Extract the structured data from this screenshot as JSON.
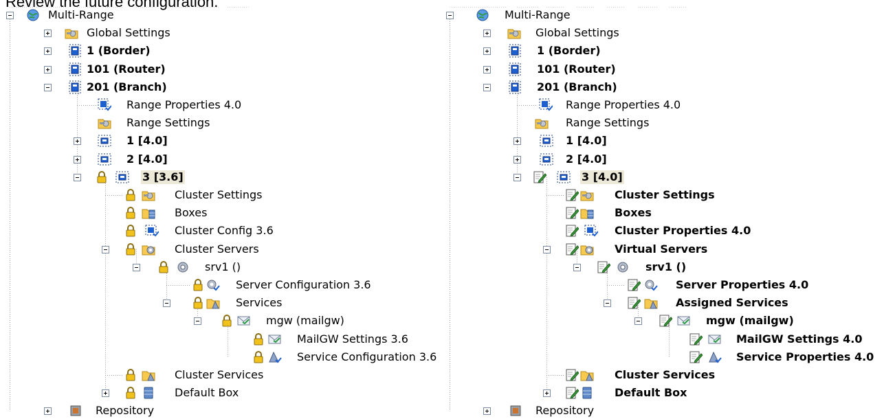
{
  "heading": "Review the future configuration.",
  "colors": {
    "tree_line": "#9c9c9c",
    "toggle_border": "#7a8aa5",
    "selection_bg": "#ece9d8",
    "folder": "#f7c94e",
    "node_blue": "#1e5fd0",
    "lock": "#f1c21b"
  },
  "left_tree": {
    "nodes": [
      {
        "label": "Multi-Range",
        "icon": "globe-icon"
      },
      {
        "label": "Global Settings",
        "icon": "settings-folder-icon"
      },
      {
        "label": "1 (Border)",
        "icon": "range-icon"
      },
      {
        "label": "101 (Router)",
        "icon": "range-icon"
      },
      {
        "label": "201 (Branch)",
        "icon": "range-icon"
      },
      {
        "label": "Range Properties 4.0",
        "icon": "range-properties-icon"
      },
      {
        "label": "Range Settings",
        "icon": "settings-folder-icon"
      },
      {
        "label": "1 [4.0]",
        "icon": "cluster-icon"
      },
      {
        "label": "2 [4.0]",
        "icon": "cluster-icon"
      },
      {
        "label": "3 [3.6]",
        "icon": "cluster-icon"
      },
      {
        "label": "Cluster Settings",
        "icon": "settings-folder-icon"
      },
      {
        "label": "Boxes",
        "icon": "boxes-folder-icon"
      },
      {
        "label": "Cluster Config 3.6",
        "icon": "cluster-config-icon"
      },
      {
        "label": "Cluster Servers",
        "icon": "servers-folder-icon"
      },
      {
        "label": "srv1 ()",
        "icon": "server-gear-icon"
      },
      {
        "label": "Server Configuration 3.6",
        "icon": "server-config-icon"
      },
      {
        "label": "Services",
        "icon": "services-folder-icon"
      },
      {
        "label": "mgw (mailgw)",
        "icon": "mail-icon"
      },
      {
        "label": "MailGW Settings 3.6",
        "icon": "mail-icon"
      },
      {
        "label": "Service Configuration 3.6",
        "icon": "service-config-icon"
      },
      {
        "label": "Cluster Services",
        "icon": "services-folder-icon"
      },
      {
        "label": "Default Box",
        "icon": "box-icon"
      },
      {
        "label": "Repository",
        "icon": "repository-icon"
      }
    ]
  },
  "right_tree": {
    "nodes": [
      {
        "label": "Multi-Range",
        "icon": "globe-icon"
      },
      {
        "label": "Global Settings",
        "icon": "settings-folder-icon"
      },
      {
        "label": "1 (Border)",
        "icon": "range-icon"
      },
      {
        "label": "101 (Router)",
        "icon": "range-icon"
      },
      {
        "label": "201 (Branch)",
        "icon": "range-icon"
      },
      {
        "label": "Range Properties 4.0",
        "icon": "range-properties-icon"
      },
      {
        "label": "Range Settings",
        "icon": "settings-folder-icon"
      },
      {
        "label": "1 [4.0]",
        "icon": "cluster-icon"
      },
      {
        "label": "2 [4.0]",
        "icon": "cluster-icon"
      },
      {
        "label": "3 [4.0]",
        "icon": "cluster-icon"
      },
      {
        "label": "Cluster Settings",
        "icon": "settings-folder-icon"
      },
      {
        "label": "Boxes",
        "icon": "boxes-folder-icon"
      },
      {
        "label": "Cluster Properties 4.0",
        "icon": "cluster-config-icon"
      },
      {
        "label": "Virtual Servers",
        "icon": "servers-folder-icon"
      },
      {
        "label": "srv1 ()",
        "icon": "server-gear-icon"
      },
      {
        "label": "Server Properties 4.0",
        "icon": "server-config-icon"
      },
      {
        "label": "Assigned Services",
        "icon": "services-folder-icon"
      },
      {
        "label": "mgw (mailgw)",
        "icon": "mail-icon"
      },
      {
        "label": "MailGW Settings 4.0",
        "icon": "mail-icon"
      },
      {
        "label": "Service Properties 4.0",
        "icon": "service-config-icon"
      },
      {
        "label": "Cluster Services",
        "icon": "services-folder-icon"
      },
      {
        "label": "Default Box",
        "icon": "box-icon"
      },
      {
        "label": "Repository",
        "icon": "repository-icon"
      }
    ]
  }
}
